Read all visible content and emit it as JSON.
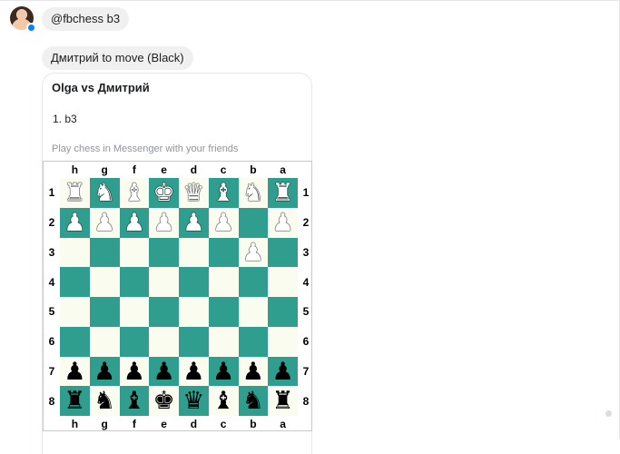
{
  "sender": {
    "avatar_icon": "user-avatar",
    "badge_icon": "messenger-badge-icon"
  },
  "messages": {
    "command": "@fbchess b3",
    "status": "Дмитрий to move (Black)"
  },
  "card": {
    "title": "Olga vs Дмитрий",
    "moves": "1. b3",
    "subtitle": "Play chess in Messenger with your friends"
  },
  "board": {
    "files": [
      "h",
      "g",
      "f",
      "e",
      "d",
      "c",
      "b",
      "a"
    ],
    "ranks": [
      "1",
      "2",
      "3",
      "4",
      "5",
      "6",
      "7",
      "8"
    ],
    "colors": {
      "light": "#fbfcf0",
      "dark": "#2f9e8f"
    },
    "rows": [
      [
        "wR",
        "wN",
        "wB",
        "wK",
        "wQ",
        "wB",
        "wN",
        "wR"
      ],
      [
        "wP",
        "wP",
        "wP",
        "wP",
        "wP",
        "wP",
        "",
        "wP"
      ],
      [
        "",
        "",
        "",
        "",
        "",
        "",
        "wP",
        ""
      ],
      [
        "",
        "",
        "",
        "",
        "",
        "",
        "",
        ""
      ],
      [
        "",
        "",
        "",
        "",
        "",
        "",
        "",
        ""
      ],
      [
        "",
        "",
        "",
        "",
        "",
        "",
        "",
        ""
      ],
      [
        "bP",
        "bP",
        "bP",
        "bP",
        "bP",
        "bP",
        "bP",
        "bP"
      ],
      [
        "bR",
        "bN",
        "bB",
        "bK",
        "bQ",
        "bB",
        "bN",
        "bR"
      ]
    ]
  }
}
